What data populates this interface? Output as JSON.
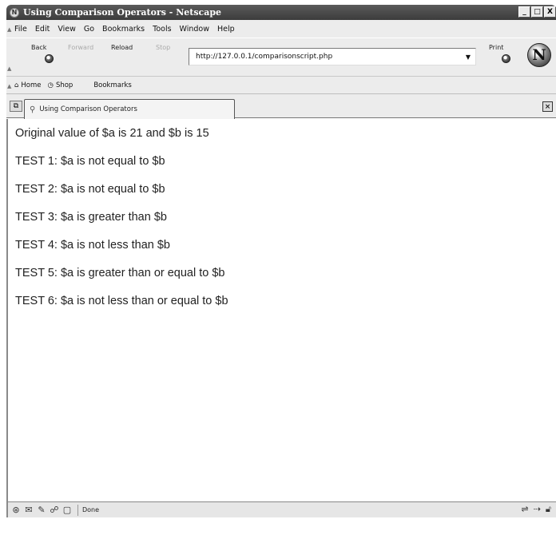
{
  "window": {
    "title": "Using Comparison Operators - Netscape",
    "controls": [
      "_",
      "□",
      "X"
    ]
  },
  "menu": {
    "items": [
      "File",
      "Edit",
      "View",
      "Go",
      "Bookmarks",
      "Tools",
      "Window",
      "Help"
    ],
    "accelerators": [
      "F",
      "E",
      "V",
      "G",
      "B",
      "T",
      "W",
      "H"
    ]
  },
  "nav": {
    "back": "Back",
    "forward": "Forward",
    "reload": "Reload",
    "stop": "Stop",
    "url": "http://127.0.0.1/comparisonscript.php",
    "print": "Print",
    "logo_letter": "N"
  },
  "bookmarks": {
    "home": "Home",
    "shop": "Shop",
    "bookmarks": "Bookmarks"
  },
  "tab": {
    "label": "Using Comparison Operators"
  },
  "content": {
    "lines": [
      "Original value of $a is 21 and $b is 15",
      "TEST 1: $a is not equal to $b",
      "TEST 2: $a is not equal to $b",
      "TEST 3: $a is greater than $b",
      "TEST 4: $a is not less than $b",
      "TEST 5: $a is greater than or equal to $b",
      "TEST 6: $a is not less than or equal to $b"
    ]
  },
  "status": {
    "text": "Done",
    "icons": [
      "netscape-icon",
      "mail-icon",
      "composer-icon",
      "chat-icon",
      "page-icon"
    ]
  }
}
